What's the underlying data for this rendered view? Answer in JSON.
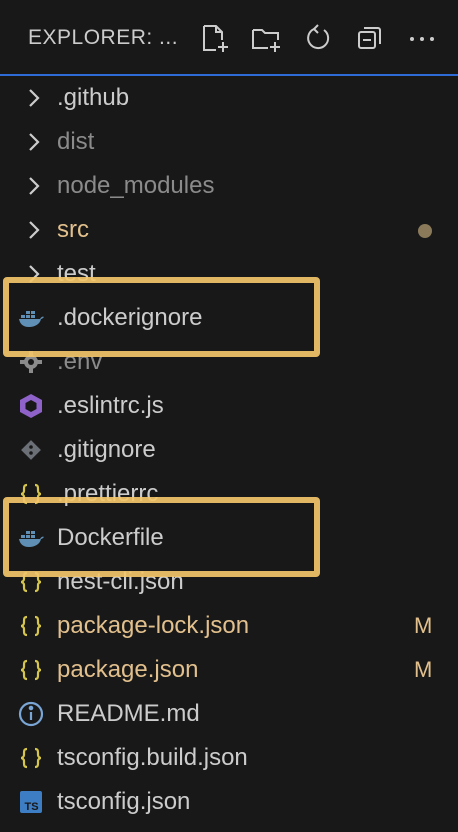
{
  "explorer": {
    "title": "EXPLORER: ...",
    "actions": [
      {
        "name": "new-file-icon"
      },
      {
        "name": "new-folder-icon"
      },
      {
        "name": "refresh-icon"
      },
      {
        "name": "collapse-all-icon"
      },
      {
        "name": "more-actions-icon"
      }
    ]
  },
  "colors": {
    "background": "#181818",
    "text": "#cccccc",
    "dimmed": "#8b8b8b",
    "modified": "#e2c08d",
    "highlight": "#f3c56b",
    "accent": "#2f6bd7"
  },
  "tree": [
    {
      "label": ".github",
      "type": "folder",
      "icon": "chevron-right-icon"
    },
    {
      "label": "dist",
      "type": "folder",
      "icon": "chevron-right-icon",
      "dimmed": true
    },
    {
      "label": "node_modules",
      "type": "folder",
      "icon": "chevron-right-icon",
      "dimmed": true
    },
    {
      "label": "src",
      "type": "folder",
      "icon": "chevron-right-icon",
      "modified": true,
      "status": "dot"
    },
    {
      "label": "test",
      "type": "folder",
      "icon": "chevron-right-icon"
    },
    {
      "label": ".dockerignore",
      "type": "file",
      "icon": "docker-icon",
      "highlighted": true
    },
    {
      "label": ".env",
      "type": "file",
      "icon": "gear-icon",
      "dimmed": true
    },
    {
      "label": ".eslintrc.js",
      "type": "file",
      "icon": "eslint-icon"
    },
    {
      "label": ".gitignore",
      "type": "file",
      "icon": "git-icon"
    },
    {
      "label": ".prettierrc",
      "type": "file",
      "icon": "json-icon"
    },
    {
      "label": "Dockerfile",
      "type": "file",
      "icon": "docker-icon",
      "highlighted": true
    },
    {
      "label": "nest-cli.json",
      "type": "file",
      "icon": "json-icon"
    },
    {
      "label": "package-lock.json",
      "type": "file",
      "icon": "json-icon",
      "modified": true,
      "status": "M"
    },
    {
      "label": "package.json",
      "type": "file",
      "icon": "json-icon",
      "modified": true,
      "status": "M"
    },
    {
      "label": "README.md",
      "type": "file",
      "icon": "info-icon"
    },
    {
      "label": "tsconfig.build.json",
      "type": "file",
      "icon": "json-icon"
    },
    {
      "label": "tsconfig.json",
      "type": "file",
      "icon": "typescript-icon"
    }
  ]
}
